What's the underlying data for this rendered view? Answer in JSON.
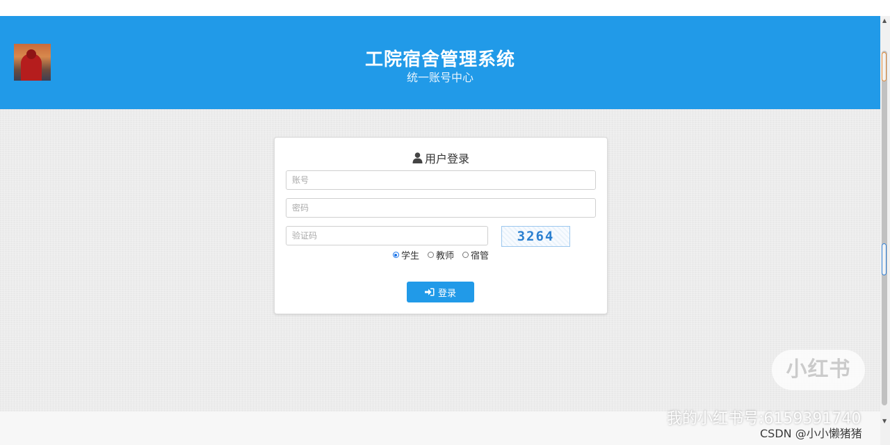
{
  "header": {
    "title": "工院宿舍管理系统",
    "subtitle": "统一账号中心"
  },
  "login": {
    "title": "用户登录",
    "account_placeholder": "账号",
    "password_placeholder": "密码",
    "captcha_placeholder": "验证码",
    "captcha_code": "3264",
    "roles": [
      {
        "label": "学生",
        "checked": true
      },
      {
        "label": "教师",
        "checked": false
      },
      {
        "label": "宿管",
        "checked": false
      }
    ],
    "submit_label": "登录"
  },
  "watermarks": {
    "logo": "小红书",
    "account": "我的小红书号:6159391740",
    "csdn": "CSDN @小小懒猪猪"
  },
  "colors": {
    "primary": "#219ae8",
    "background": "#ececec"
  },
  "icons": {
    "user": "user-icon",
    "login": "sign-in-icon"
  }
}
